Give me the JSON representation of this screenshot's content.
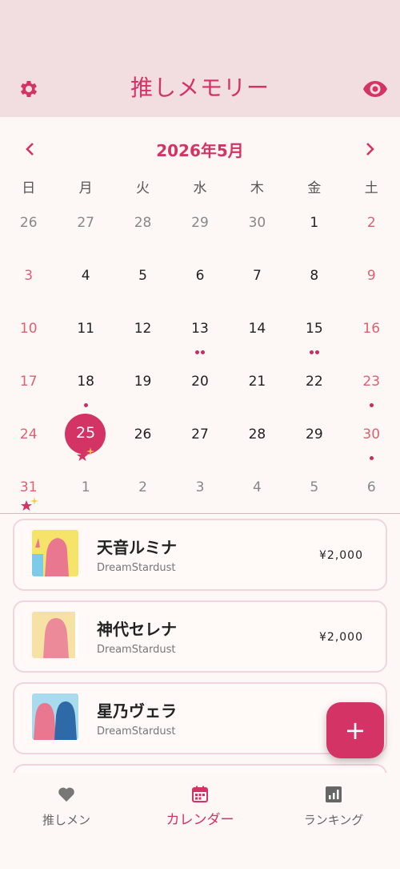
{
  "header": {
    "title": "推しメモリー",
    "left_icon": "gear-icon",
    "right_icon": "eye-icon"
  },
  "calendar": {
    "month_label": "2026年5月",
    "weekdays": [
      "日",
      "月",
      "火",
      "水",
      "木",
      "金",
      "土"
    ],
    "weeks": [
      [
        "26",
        "27",
        "28",
        "29",
        "30",
        "1",
        "2"
      ],
      [
        "3",
        "4",
        "5",
        "6",
        "7",
        "8",
        "9"
      ],
      [
        "10",
        "11",
        "12",
        "13",
        "14",
        "15",
        "16"
      ],
      [
        "17",
        "18",
        "19",
        "20",
        "21",
        "22",
        "23"
      ],
      [
        "24",
        "25",
        "26",
        "27",
        "28",
        "29",
        "30"
      ],
      [
        "31",
        "1",
        "2",
        "3",
        "4",
        "5",
        "6"
      ]
    ],
    "today": "25"
  },
  "entries": [
    {
      "name": "天音ルミナ",
      "group": "DreamStardust",
      "price": "¥2,000"
    },
    {
      "name": "神代セレナ",
      "group": "DreamStardust",
      "price": "¥2,000"
    },
    {
      "name": "星乃ヴェラ",
      "group": "DreamStardust",
      "price": "¥"
    }
  ],
  "fab_label": "+",
  "tabs": [
    {
      "label": "推しメン",
      "icon": "heart-icon"
    },
    {
      "label": "カレンダー",
      "icon": "calendar-icon"
    },
    {
      "label": "ランキング",
      "icon": "chart-icon"
    }
  ],
  "colors": {
    "accent": "#d43366",
    "header_bg": "#f2dde1",
    "weekend": "#e06070"
  }
}
